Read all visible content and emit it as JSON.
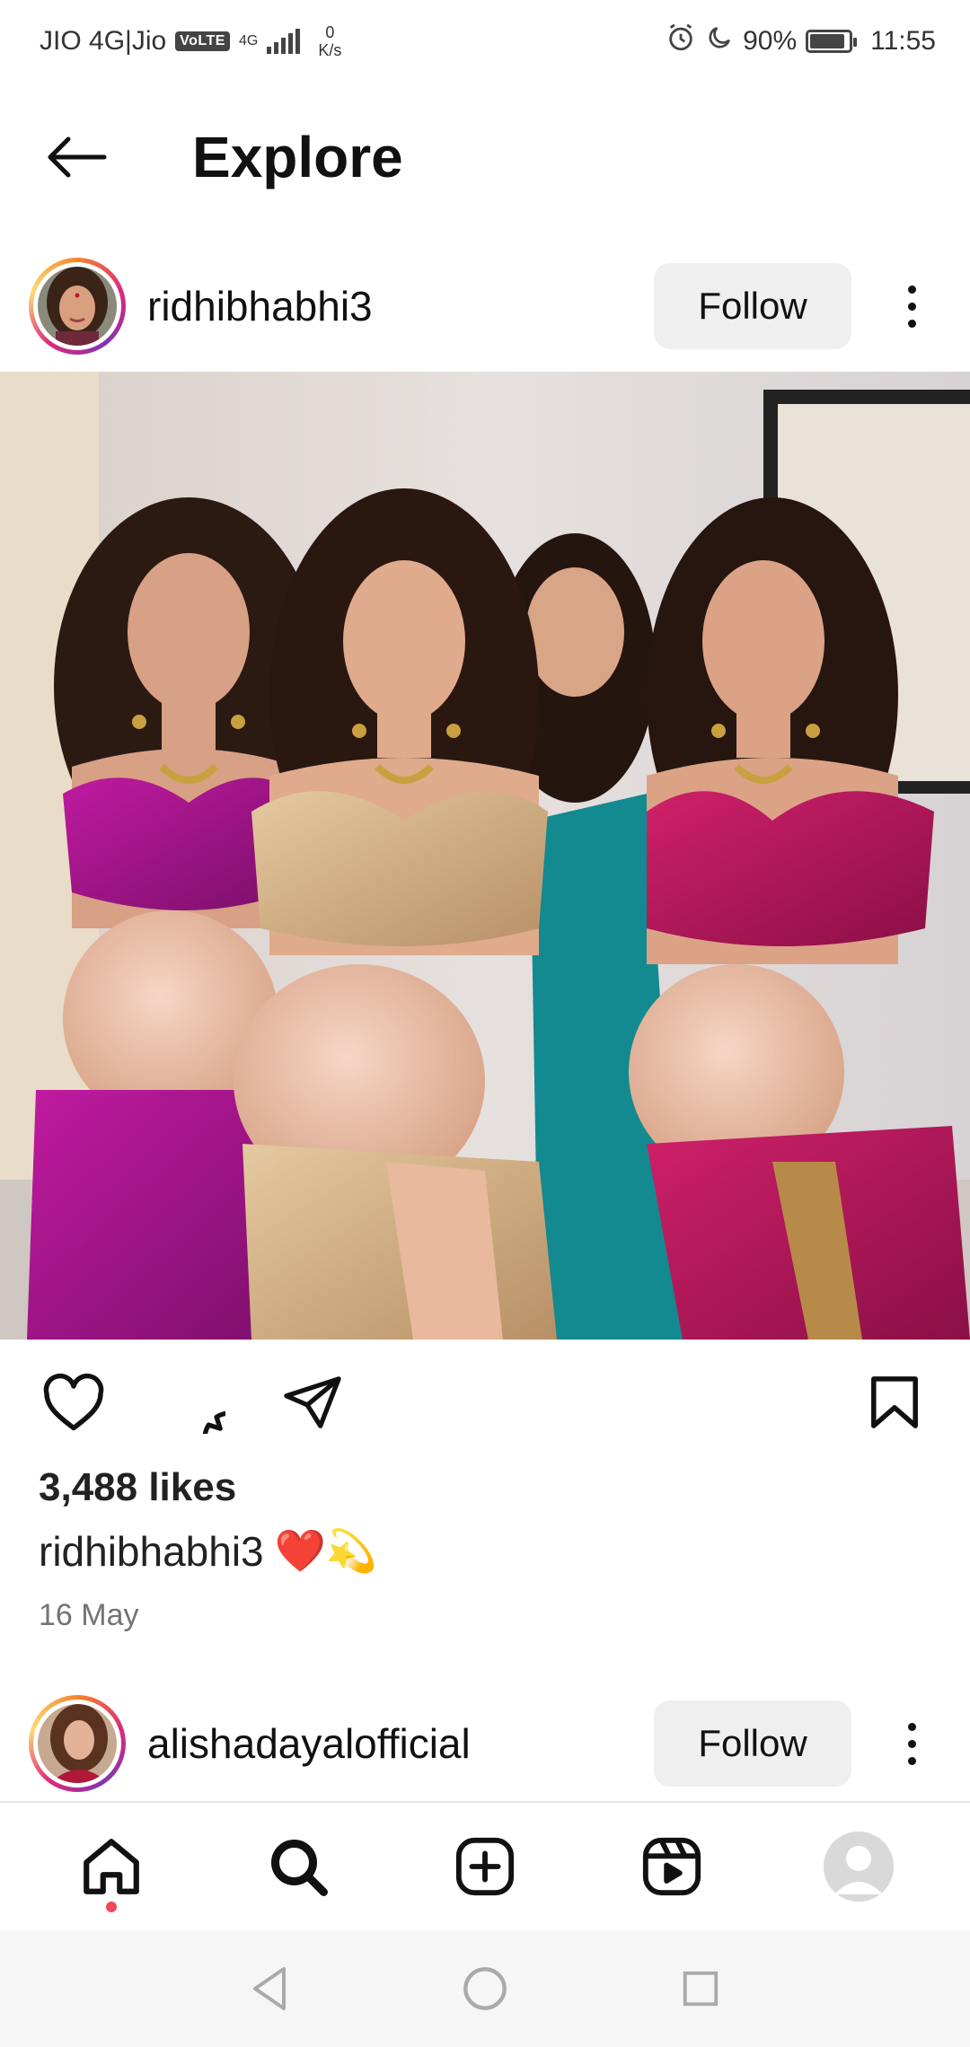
{
  "status_bar": {
    "carrier": "JIO 4G|Jio",
    "volte": "VoLTE",
    "network": "4G",
    "speed_value": "0",
    "speed_unit": "K/s",
    "battery": "90%",
    "battery_level": 0.9,
    "time": "11:55",
    "icons": [
      "alarm-icon",
      "moon-icon",
      "battery-icon",
      "signal-icon"
    ]
  },
  "header": {
    "title": "Explore",
    "back_icon": "back-arrow-icon"
  },
  "posts": [
    {
      "username": "ridhibhabhi3",
      "follow_label": "Follow",
      "likes": "3,488 likes",
      "caption_user": "ridhibhabhi3",
      "caption_emojis": "❤️💫",
      "date": "16 May"
    },
    {
      "username": "alishadayalofficial",
      "follow_label": "Follow"
    }
  ],
  "actions": [
    "heart-icon",
    "comment-icon",
    "share-icon",
    "bookmark-icon"
  ],
  "bottom_nav": {
    "items": [
      "home-icon",
      "search-icon",
      "add-post-icon",
      "reels-icon",
      "profile-avatar"
    ],
    "active": "home-icon"
  },
  "system_nav": [
    "back-triangle-icon",
    "home-circle-icon",
    "recents-square-icon"
  ],
  "colors": {
    "follow_bg": "#efefef",
    "notification_dot": "#ed4956",
    "date_gray": "#737373",
    "story_ring_start": "#f58529",
    "story_ring_end": "#dd2a7b"
  }
}
